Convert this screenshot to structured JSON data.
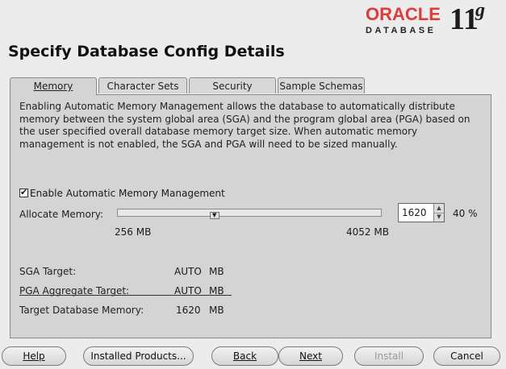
{
  "brand": {
    "oracle": "ORACLE",
    "database": "DATABASE",
    "version": "11",
    "version_suffix": "g"
  },
  "page": {
    "title": "Specify Database Config Details"
  },
  "tabs": [
    {
      "label": "Memory",
      "active": true
    },
    {
      "label": "Character Sets",
      "active": false
    },
    {
      "label": "Security",
      "active": false
    },
    {
      "label": "Sample Schemas",
      "active": false
    }
  ],
  "memory": {
    "description": "Enabling Automatic Memory Management allows the database to automatically distribute memory between the system global area (SGA) and the program global area (PGA) based on the user specified overall database memory target size. When automatic memory management is not enabled, the SGA and PGA will need to be sized manually.",
    "enable_amm_label": "Enable Automatic Memory Management",
    "enable_amm_checked": true,
    "allocate_label": "Allocate Memory:",
    "slider_min_label": "256 MB",
    "slider_max_label": "4052 MB",
    "allocate_value": "1620",
    "percent": "40 %",
    "rows": [
      {
        "label": "SGA Target:",
        "value": "AUTO",
        "unit": "MB"
      },
      {
        "label": "PGA Aggregate Target:",
        "value": "AUTO",
        "unit": "MB"
      },
      {
        "label": "Target Database Memory:",
        "value": "1620",
        "unit": "MB"
      }
    ]
  },
  "buttons": {
    "help": "Help",
    "installed_products": "Installed Products...",
    "back": "Back",
    "next": "Next",
    "install": "Install",
    "cancel": "Cancel"
  }
}
